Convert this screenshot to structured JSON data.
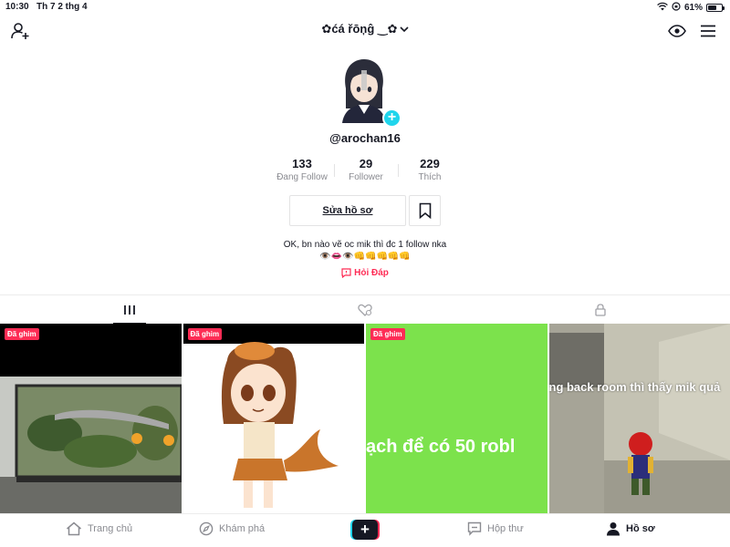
{
  "status_bar": {
    "time": "10:30",
    "date": "Th 7 2 thg 4",
    "battery": "61%",
    "battery_level": 0.61
  },
  "header": {
    "username": "✿ćá řōņĝ ‿✿"
  },
  "profile": {
    "handle": "@arochan16",
    "stats": [
      {
        "value": "133",
        "label": "Đang Follow"
      },
      {
        "value": "29",
        "label": "Follower"
      },
      {
        "value": "229",
        "label": "Thích"
      }
    ],
    "edit_button": "Sửa hồ sơ",
    "bio_line1": "OK, bn nào vẽ oc mik thì đc 1 follow nka",
    "bio_line2": "👁️👄👁️👊👊👊👊👊",
    "qa_label": "Hỏi Đáp"
  },
  "videos": [
    {
      "pin": "Đã ghim",
      "caption": ""
    },
    {
      "pin": "Đã ghim",
      "caption": ""
    },
    {
      "pin": "Đã ghim",
      "caption": "ạch để có 50 robl"
    },
    {
      "pin": "",
      "caption": "ng back room  thì thấy mik quả"
    }
  ],
  "bottom_nav": {
    "home": "Trang chủ",
    "explore": "Khám phá",
    "inbox": "Hộp thư",
    "profile": "Hồ sơ"
  },
  "colors": {
    "accent": "#fe2c55",
    "cyan": "#20d5ec",
    "text": "#161823",
    "muted": "#8a8b91",
    "green_thumb": "#7ce24c"
  }
}
